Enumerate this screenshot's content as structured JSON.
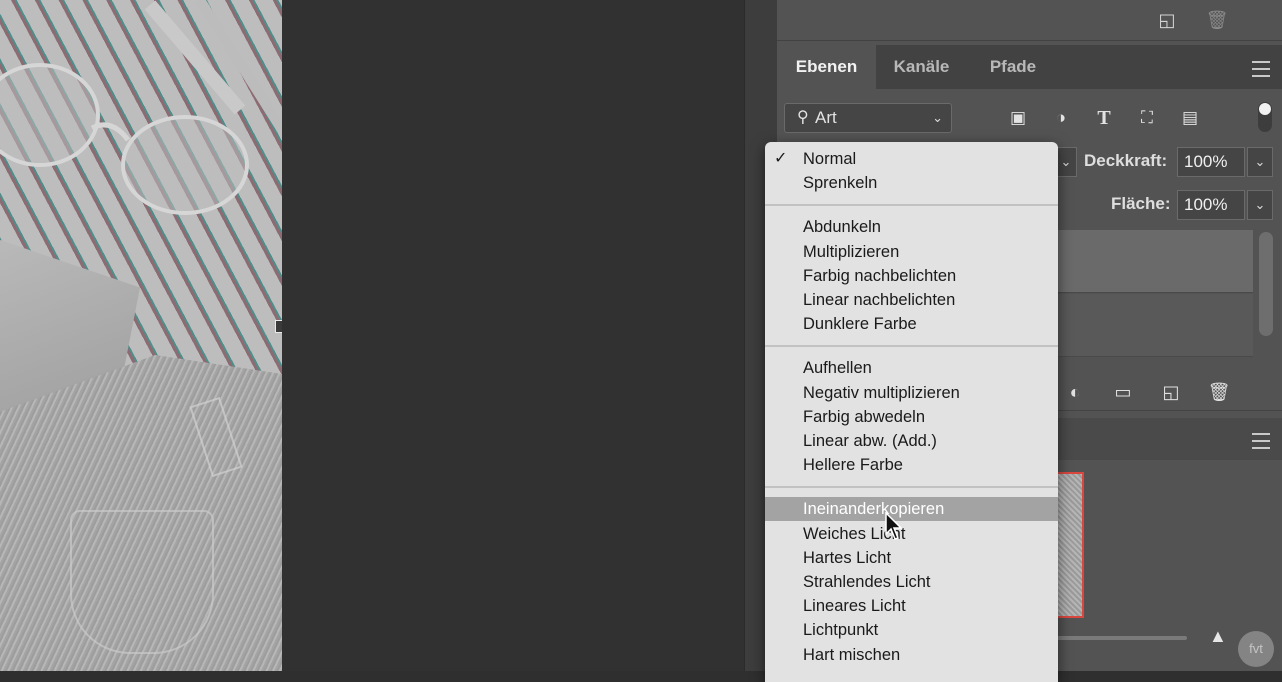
{
  "panel": {
    "tabs": [
      "Ebenen",
      "Kanäle",
      "Pfade"
    ],
    "filter": {
      "kind_label": "Art"
    },
    "opacity": {
      "label": "Deckkraft:",
      "value": "100%"
    },
    "fill": {
      "label": "Fläche:",
      "value": "100%"
    }
  },
  "blend_menu": {
    "selected": "Normal",
    "highlighted": "Ineinanderkopieren",
    "groups": [
      [
        "Normal",
        "Sprenkeln"
      ],
      [
        "Abdunkeln",
        "Multiplizieren",
        "Farbig nachbelichten",
        "Linear nachbelichten",
        "Dunklere Farbe"
      ],
      [
        "Aufhellen",
        "Negativ multiplizieren",
        "Farbig abwedeln",
        "Linear abw. (Add.)",
        "Hellere Farbe"
      ],
      [
        "Ineinanderkopieren",
        "Weiches Licht",
        "Hartes Licht",
        "Strahlendes Licht",
        "Lineares Licht",
        "Lichtpunkt",
        "Hart mischen"
      ]
    ]
  },
  "watermark": "fvt",
  "colors": {
    "panel_bg": "#535353",
    "menu_bg": "#e2e2e2",
    "highlight": "#a3a3a3",
    "thumb_border": "#d9473f"
  }
}
